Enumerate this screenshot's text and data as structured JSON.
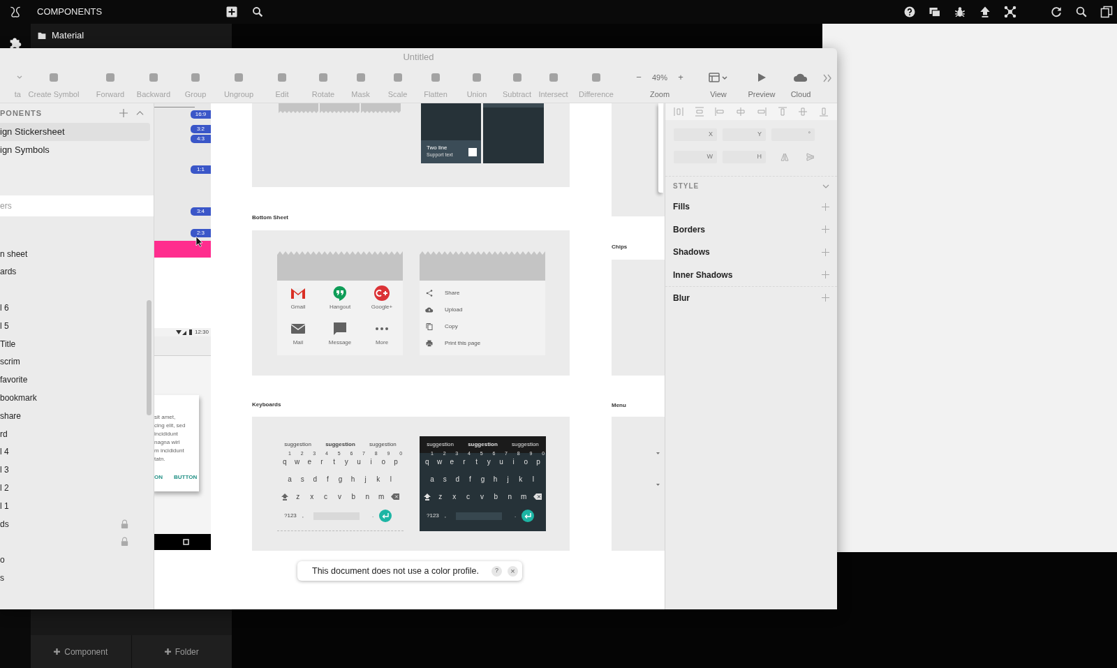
{
  "app_bar": {
    "title": "COMPONENTS"
  },
  "library": {
    "folder": "Material",
    "buttons": [
      {
        "label": "Component"
      },
      {
        "label": "Folder"
      }
    ]
  },
  "window": {
    "title": "Untitled"
  },
  "toolbar": {
    "items": [
      {
        "kind": "tool",
        "label": "ta",
        "disabled": true
      },
      {
        "kind": "tool",
        "label": "Create Symbol",
        "disabled": true
      },
      {
        "kind": "tool",
        "label": "Forward",
        "disabled": true
      },
      {
        "kind": "tool",
        "label": "Backward",
        "disabled": true
      },
      {
        "kind": "tool",
        "label": "Group",
        "disabled": true
      },
      {
        "kind": "tool",
        "label": "Ungroup",
        "disabled": true
      },
      {
        "kind": "tool",
        "label": "Edit",
        "disabled": true
      },
      {
        "kind": "tool",
        "label": "Rotate",
        "disabled": true
      },
      {
        "kind": "tool",
        "label": "Mask",
        "disabled": true
      },
      {
        "kind": "tool",
        "label": "Scale",
        "disabled": true
      },
      {
        "kind": "tool",
        "label": "Flatten",
        "disabled": true
      },
      {
        "kind": "tool",
        "label": "Union",
        "disabled": true
      },
      {
        "kind": "tool",
        "label": "Subtract",
        "disabled": true
      },
      {
        "kind": "tool",
        "label": "Intersect",
        "disabled": true
      },
      {
        "kind": "tool",
        "label": "Difference",
        "disabled": true
      },
      {
        "kind": "zoom",
        "label": "Zoom",
        "minus": "−",
        "value": "49%",
        "plus": "+",
        "disabled": false
      },
      {
        "kind": "view",
        "label": "View",
        "disabled": false
      },
      {
        "kind": "preview",
        "label": "Preview",
        "disabled": false
      },
      {
        "kind": "cloud",
        "label": "Cloud",
        "disabled": false
      }
    ]
  },
  "components_panel": {
    "header": "PONENTS",
    "items": [
      {
        "label": "ign Stickersheet",
        "selected": true
      },
      {
        "label": "ign Symbols",
        "selected": false
      }
    ]
  },
  "layers": {
    "filter_placeholder": "ers",
    "items": [
      {
        "locked": false
      },
      {
        "label": "n sheet",
        "locked": false
      },
      {
        "label": "ards",
        "locked": false
      },
      {
        "locked": false
      },
      {
        "label": "l 6",
        "locked": false
      },
      {
        "label": "l 5",
        "locked": false
      },
      {
        "label": "Title",
        "locked": false
      },
      {
        "label": "scrim",
        "locked": false
      },
      {
        "label": "favorite",
        "locked": false
      },
      {
        "label": "bookmark",
        "locked": false
      },
      {
        "label": "share",
        "locked": false
      },
      {
        "label": "rd",
        "locked": false
      },
      {
        "label": "l 4",
        "locked": false
      },
      {
        "label": "l 3",
        "locked": false
      },
      {
        "label": "l 2",
        "locked": false
      },
      {
        "label": "l 1",
        "locked": false
      },
      {
        "label": "ds",
        "locked": true
      },
      {
        "locked": true
      },
      {
        "label": "o",
        "locked": false
      },
      {
        "label": "s",
        "locked": false
      }
    ]
  },
  "canvas": {
    "ratio_tags": [
      "16:9",
      "3:2",
      "4:3",
      "1:1",
      "3:4",
      "2:3"
    ],
    "status_time": "12:30",
    "card_lines": [
      "sit amet,",
      "cing elit, sed",
      "incididunt",
      "nagna wirl",
      "m incididunt",
      "tatn."
    ],
    "card_buttons": [
      "ON",
      "BUTTON"
    ],
    "tile": {
      "title": "Two line",
      "subtitle": "Support text",
      "checked": false
    },
    "section_labels": [
      "Bottom Sheet",
      "Keyboards",
      "Chips",
      "Menu"
    ],
    "grid_sheet": [
      {
        "kind": "gmail",
        "label": "Gmail"
      },
      {
        "kind": "hangout",
        "label": "Hangout"
      },
      {
        "kind": "gplus",
        "label": "Google+"
      },
      {
        "kind": "mail",
        "label": "Mail"
      },
      {
        "kind": "message",
        "label": "Message"
      },
      {
        "kind": "more",
        "label": "More"
      }
    ],
    "list_sheet": [
      {
        "kind": "share",
        "label": "Share"
      },
      {
        "kind": "upload",
        "label": "Upload"
      },
      {
        "kind": "copy",
        "label": "Copy"
      },
      {
        "kind": "print",
        "label": "Print this page"
      }
    ],
    "keyboards": [
      {
        "kind": "light",
        "suggestions": [
          {
            "text": "suggestion",
            "selected": false
          },
          {
            "text": "suggestion",
            "selected": true
          },
          {
            "text": "suggestion",
            "selected": false
          }
        ],
        "hints": [
          "1",
          "2",
          "3",
          "4",
          "5",
          "6",
          "7",
          "8",
          "9",
          "0"
        ],
        "rows": [
          [
            "q",
            "w",
            "e",
            "r",
            "t",
            "y",
            "u",
            "i",
            "o",
            "p"
          ],
          [
            "a",
            "s",
            "d",
            "f",
            "g",
            "h",
            "j",
            "k",
            "l"
          ],
          [
            "z",
            "x",
            "c",
            "v",
            "b",
            "n",
            "m"
          ]
        ],
        "symbols": "?123",
        "comma": ",",
        "period": "."
      },
      {
        "kind": "dark",
        "suggestions": [
          {
            "text": "suggestion",
            "selected": false
          },
          {
            "text": "suggestion",
            "selected": true
          },
          {
            "text": "suggestion",
            "selected": false
          }
        ],
        "hints": [
          "1",
          "2",
          "3",
          "4",
          "5",
          "6",
          "7",
          "8",
          "9",
          "0"
        ],
        "rows": [
          [
            "q",
            "w",
            "e",
            "r",
            "t",
            "y",
            "u",
            "i",
            "o",
            "p"
          ],
          [
            "a",
            "s",
            "d",
            "f",
            "g",
            "h",
            "j",
            "k",
            "l"
          ],
          [
            "z",
            "x",
            "c",
            "v",
            "b",
            "n",
            "m"
          ]
        ],
        "symbols": "?123",
        "comma": ",",
        "period": "."
      }
    ]
  },
  "inspector": {
    "fields": [
      "X",
      "Y",
      "°",
      "W",
      "H"
    ],
    "style_header": "STYLE",
    "sections": [
      "Fills",
      "Borders",
      "Shadows",
      "Inner Shadows",
      "Blur"
    ]
  },
  "toast": {
    "message": "This document does not use a color profile.",
    "help": "?",
    "close": "×"
  }
}
